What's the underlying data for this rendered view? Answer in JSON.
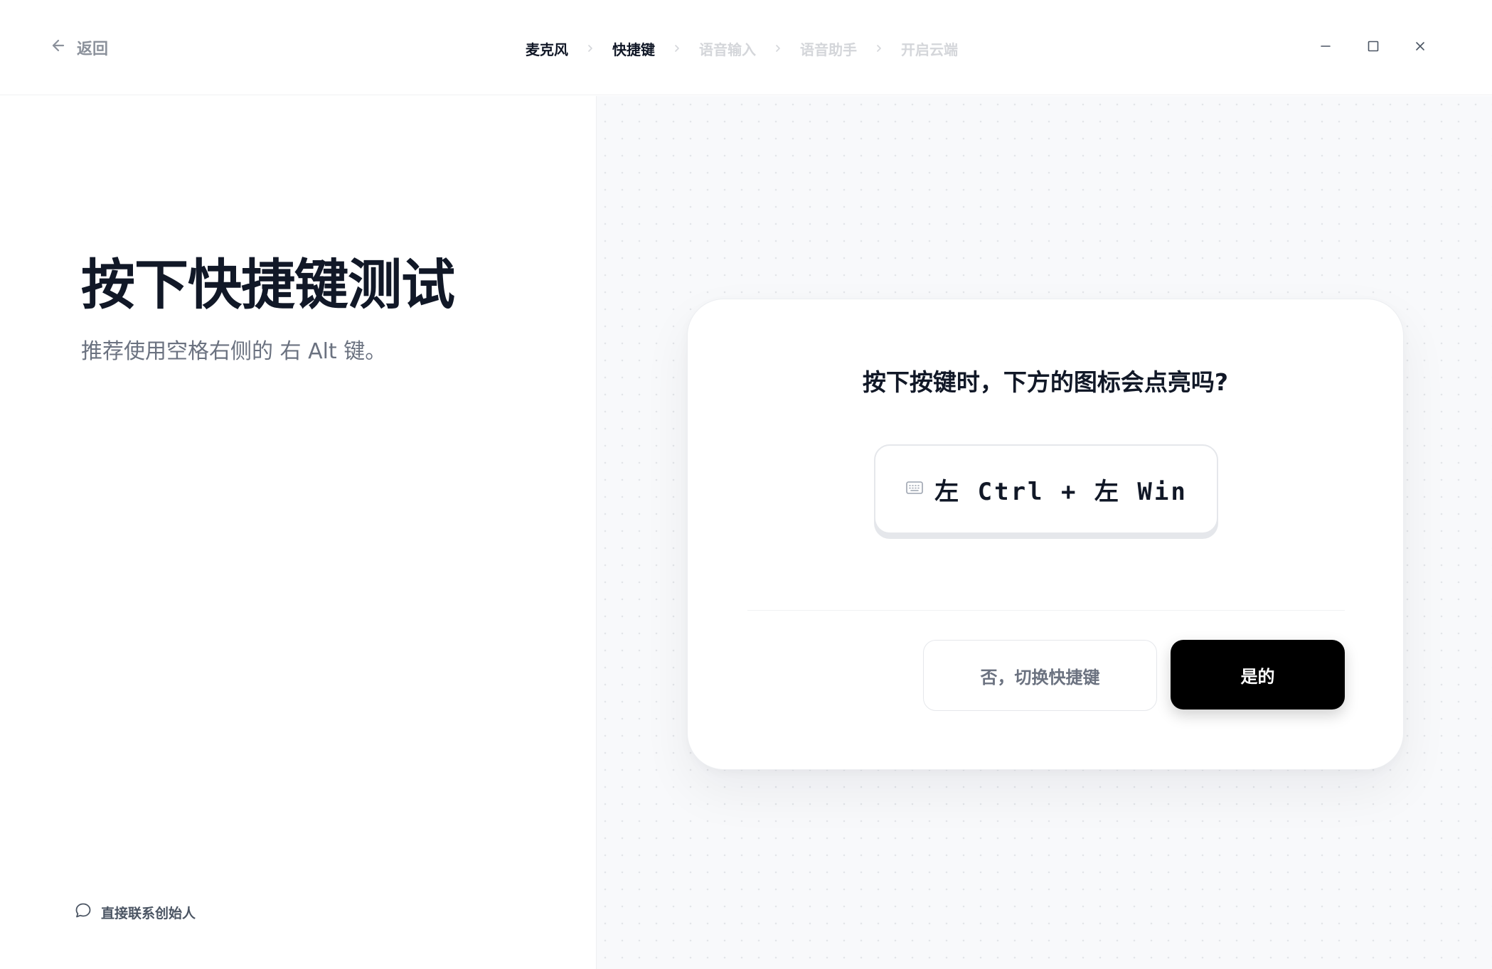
{
  "header": {
    "back_label": "返回",
    "steps": [
      {
        "label": "麦克风",
        "state": "done"
      },
      {
        "label": "快捷键",
        "state": "active"
      },
      {
        "label": "语音输入",
        "state": "pending"
      },
      {
        "label": "语音助手",
        "state": "pending"
      },
      {
        "label": "开启云端",
        "state": "pending"
      }
    ],
    "window_controls": [
      "minimize-icon",
      "maximize-icon",
      "close-icon"
    ]
  },
  "left": {
    "title": "按下快捷键测试",
    "subtitle": "推荐使用空格右侧的 右 Alt 键。",
    "contact_label": "直接联系创始人"
  },
  "card": {
    "question": "按下按键时，下方的图标会点亮吗?",
    "shortcut": "左 Ctrl + 左 Win",
    "no_label": "否，切换快捷键",
    "yes_label": "是的"
  },
  "colors": {
    "primary_button": "#000000",
    "text_dark": "#111827",
    "text_muted": "#6b7280",
    "step_pending": "#d4d6da",
    "pane_bg": "#f8f9fb"
  }
}
